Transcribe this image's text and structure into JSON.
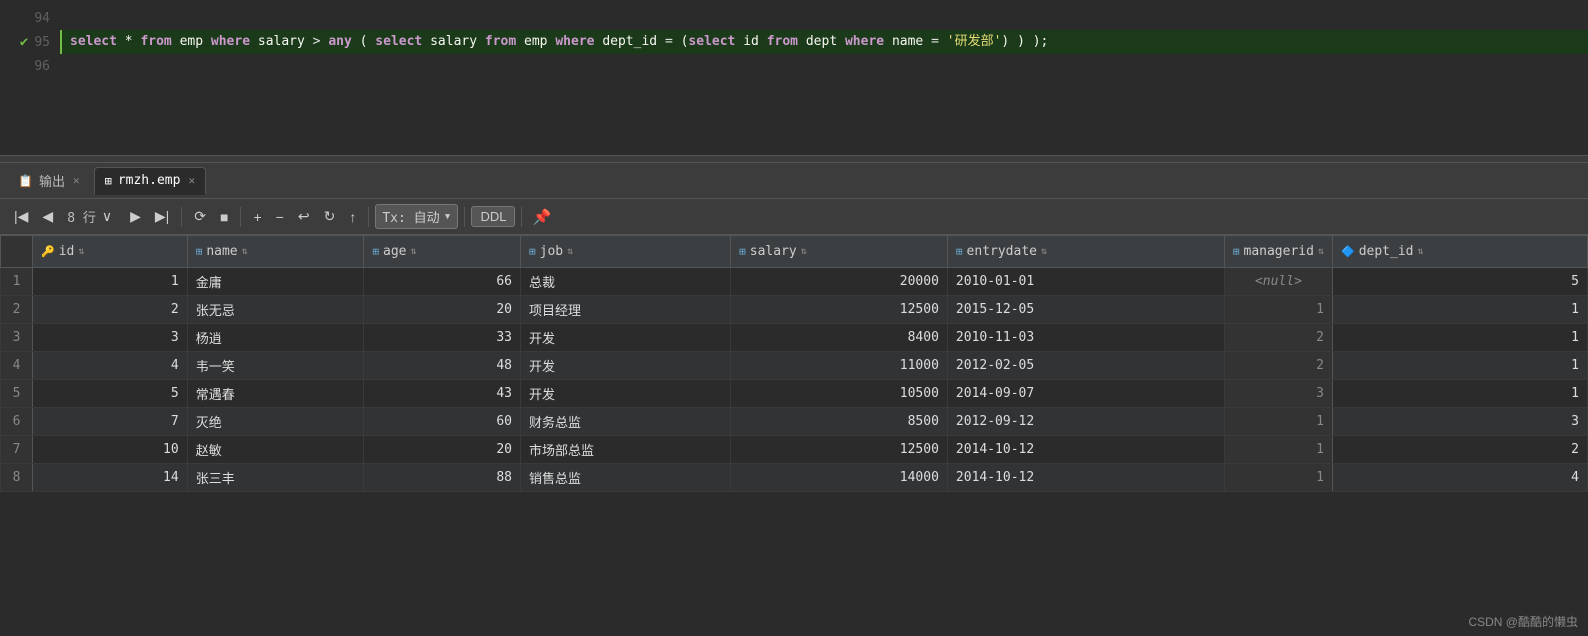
{
  "editor": {
    "lines": [
      {
        "num": "94",
        "content": "",
        "active": false,
        "check": false
      },
      {
        "num": "95",
        "content": "select * from emp where salary > any ( select salary from emp where dept_id = (select id from dept where name = '研发部') );",
        "active": true,
        "check": true
      },
      {
        "num": "96",
        "content": "",
        "active": false,
        "check": false
      }
    ]
  },
  "tabs": [
    {
      "id": "output",
      "label": "输出",
      "icon": "📋",
      "active": false,
      "closable": true
    },
    {
      "id": "rmzh-emp",
      "label": "rmzh.emp",
      "icon": "⊞",
      "active": true,
      "closable": true
    }
  ],
  "toolbar": {
    "row_info": "8 行",
    "tx_label": "Tx: 自动",
    "ddl_label": "DDL",
    "buttons": {
      "first": "|<",
      "prev": "<",
      "next": ">",
      "last": ">|",
      "refresh": "⟳",
      "stop": "■",
      "add": "+",
      "remove": "−",
      "undo": "↩",
      "redo": "↻",
      "upload": "↑"
    }
  },
  "columns": [
    {
      "name": "id",
      "icon": "key"
    },
    {
      "name": "name",
      "icon": "table"
    },
    {
      "name": "age",
      "icon": "table"
    },
    {
      "name": "job",
      "icon": "table"
    },
    {
      "name": "salary",
      "icon": "table"
    },
    {
      "name": "entrydate",
      "icon": "table"
    },
    {
      "name": "managerid",
      "icon": "table"
    },
    {
      "name": "dept_id",
      "icon": "pk"
    }
  ],
  "rows": [
    {
      "row": 1,
      "id": 1,
      "name": "金庸",
      "age": 66,
      "job": "总裁",
      "salary": 20000,
      "entrydate": "2010-01-01",
      "managerid": "<null>",
      "dept_id": 5
    },
    {
      "row": 2,
      "id": 2,
      "name": "张无忌",
      "age": 20,
      "job": "项目经理",
      "salary": 12500,
      "entrydate": "2015-12-05",
      "managerid": 1,
      "dept_id": 1
    },
    {
      "row": 3,
      "id": 3,
      "name": "杨逍",
      "age": 33,
      "job": "开发",
      "salary": 8400,
      "entrydate": "2010-11-03",
      "managerid": 2,
      "dept_id": 1
    },
    {
      "row": 4,
      "id": 4,
      "name": "韦一笑",
      "age": 48,
      "job": "开发",
      "salary": 11000,
      "entrydate": "2012-02-05",
      "managerid": 2,
      "dept_id": 1
    },
    {
      "row": 5,
      "id": 5,
      "name": "常遇春",
      "age": 43,
      "job": "开发",
      "salary": 10500,
      "entrydate": "2014-09-07",
      "managerid": 3,
      "dept_id": 1
    },
    {
      "row": 6,
      "id": 7,
      "name": "灭绝",
      "age": 60,
      "job": "财务总监",
      "salary": 8500,
      "entrydate": "2012-09-12",
      "managerid": 1,
      "dept_id": 3
    },
    {
      "row": 7,
      "id": 10,
      "name": "赵敏",
      "age": 20,
      "job": "市场部总监",
      "salary": 12500,
      "entrydate": "2014-10-12",
      "managerid": 1,
      "dept_id": 2
    },
    {
      "row": 8,
      "id": 14,
      "name": "张三丰",
      "age": 88,
      "job": "销售总监",
      "salary": 14000,
      "entrydate": "2014-10-12",
      "managerid": 1,
      "dept_id": 4
    }
  ],
  "watermark": "CSDN @酷酷的懒虫"
}
